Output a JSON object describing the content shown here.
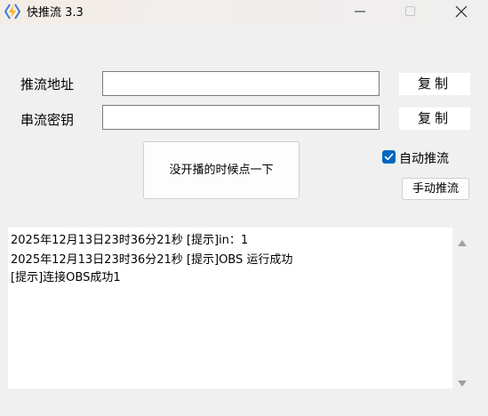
{
  "window": {
    "title": "快推流 3.3",
    "icon": "lightning-bolt-icon",
    "controls": [
      "minimize-icon",
      "maximize-icon",
      "close-icon"
    ]
  },
  "form": {
    "push_address_label": "推流地址",
    "push_address_value": "",
    "stream_key_label": "串流密钥",
    "stream_key_value": "",
    "copy_label_1": "复制",
    "copy_label_2": "复制"
  },
  "actions": {
    "big_button_label": "没开播的时候点一下",
    "auto_push_label": "自动推流",
    "auto_push_checked": true,
    "manual_push_label": "手动推流"
  },
  "log": {
    "lines": [
      "2025年12月13日23时36分21秒 [提示]in：1",
      "2025年12月13日23时36分21秒 [提示]OBS 运行成功",
      "[提示]连接OBS成功1"
    ]
  },
  "colors": {
    "accent": "#0067c0",
    "background": "#f0f0f0",
    "icon_yellow": "#f5b400",
    "icon_blue": "#3a7bd5"
  }
}
